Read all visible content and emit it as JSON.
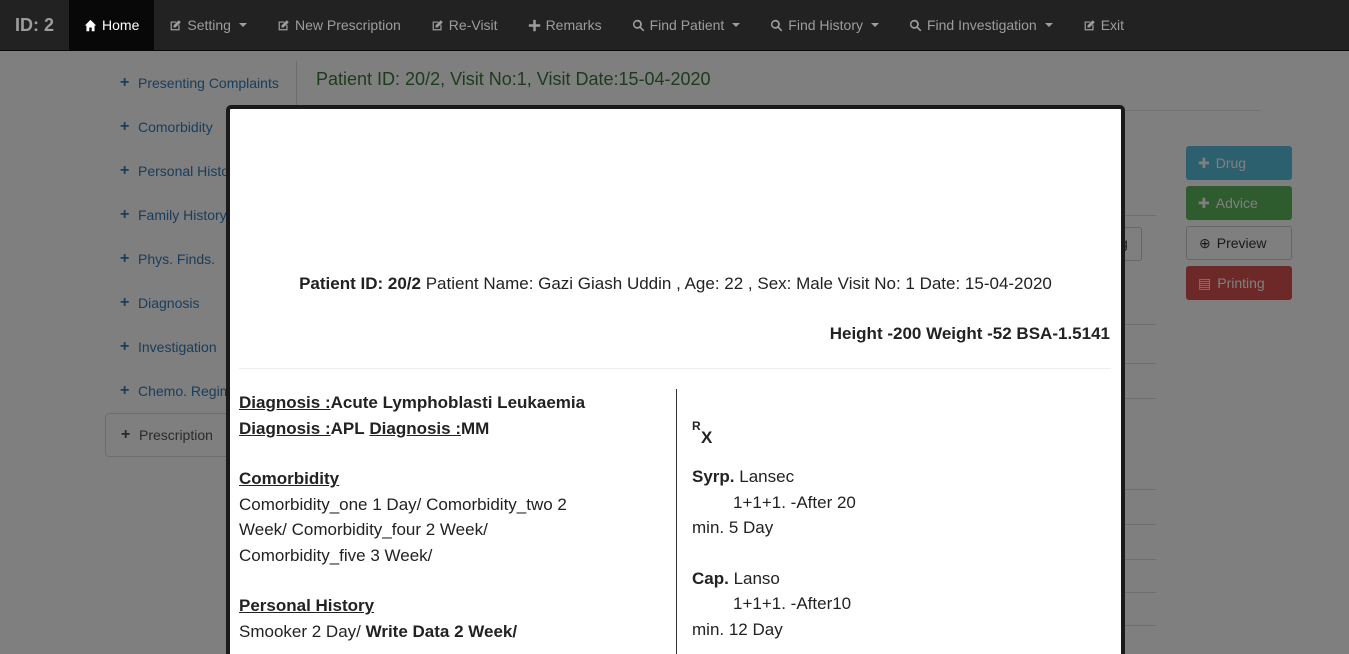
{
  "navbar": {
    "brand": "ID: 2",
    "items": [
      {
        "label": "Home",
        "icon": "home-icon",
        "active": true,
        "dropdown": false
      },
      {
        "label": "Setting",
        "icon": "edit-icon",
        "dropdown": true
      },
      {
        "label": "New Prescription",
        "icon": "edit-icon",
        "dropdown": false
      },
      {
        "label": "Re-Visit",
        "icon": "edit-icon",
        "dropdown": false
      },
      {
        "label": "Remarks",
        "icon": "plus-icon",
        "dropdown": false
      },
      {
        "label": "Find Patient",
        "icon": "search-icon",
        "dropdown": true
      },
      {
        "label": "Find History",
        "icon": "search-icon",
        "dropdown": true
      },
      {
        "label": "Find Investigation",
        "icon": "search-icon",
        "dropdown": true
      },
      {
        "label": "Exit",
        "icon": "edit-icon",
        "dropdown": false
      }
    ]
  },
  "sidebar": {
    "items": [
      {
        "label": "Presenting Complaints"
      },
      {
        "label": "Comorbidity"
      },
      {
        "label": "Personal History"
      },
      {
        "label": "Family History"
      },
      {
        "label": "Phys. Finds."
      },
      {
        "label": "Diagnosis"
      },
      {
        "label": "Investigation"
      },
      {
        "label": "Chemo. Regimen"
      },
      {
        "label": "Prescription"
      }
    ]
  },
  "header": {
    "patient_line": "Patient ID: 20/2,  Visit No:1, Visit Date:15-04-2020"
  },
  "actions": {
    "drug": "Drug",
    "advice": "Advice",
    "preview": "Preview",
    "printing": "Printing",
    "bg_button_letter": "g"
  },
  "modal": {
    "patient_id_label": "Patient ID: 20/2",
    "patient_details": " Patient Name: Gazi Giash Uddin , Age: 22 , Sex: Male Visit No: 1 Date: 15-04-2020",
    "measurements": "Height -200 Weight -52 BSA-1.5141",
    "diagnosis_label": "Diagnosis :",
    "diagnosis_1": "Acute Lymphoblasti Leukaemia",
    "diagnosis_2": "APL",
    "diagnosis_3": "MM",
    "comorbidity_heading": "Comorbidity",
    "comorbidity_text": "Comorbidity_one 1 Day/ Comorbidity_two 2 Week/ Comorbidity_four 2 Week/ Comorbidity_five 3 Week/",
    "personal_history_heading": "Personal History",
    "personal_history_plain": "Smooker 2 Day/ ",
    "personal_history_bold": "Write Data 2 Week/",
    "rx_r": "R",
    "rx_x": "X",
    "drugs": [
      {
        "form": "Syrp.",
        "name": " Lansec",
        "dose": "1+1+1. -After 20",
        "duration": "min. 5 Day"
      },
      {
        "form": "Cap.",
        "name": " Lanso",
        "dose": "1+1+1. -After10",
        "duration": "min. 12 Day"
      }
    ]
  }
}
